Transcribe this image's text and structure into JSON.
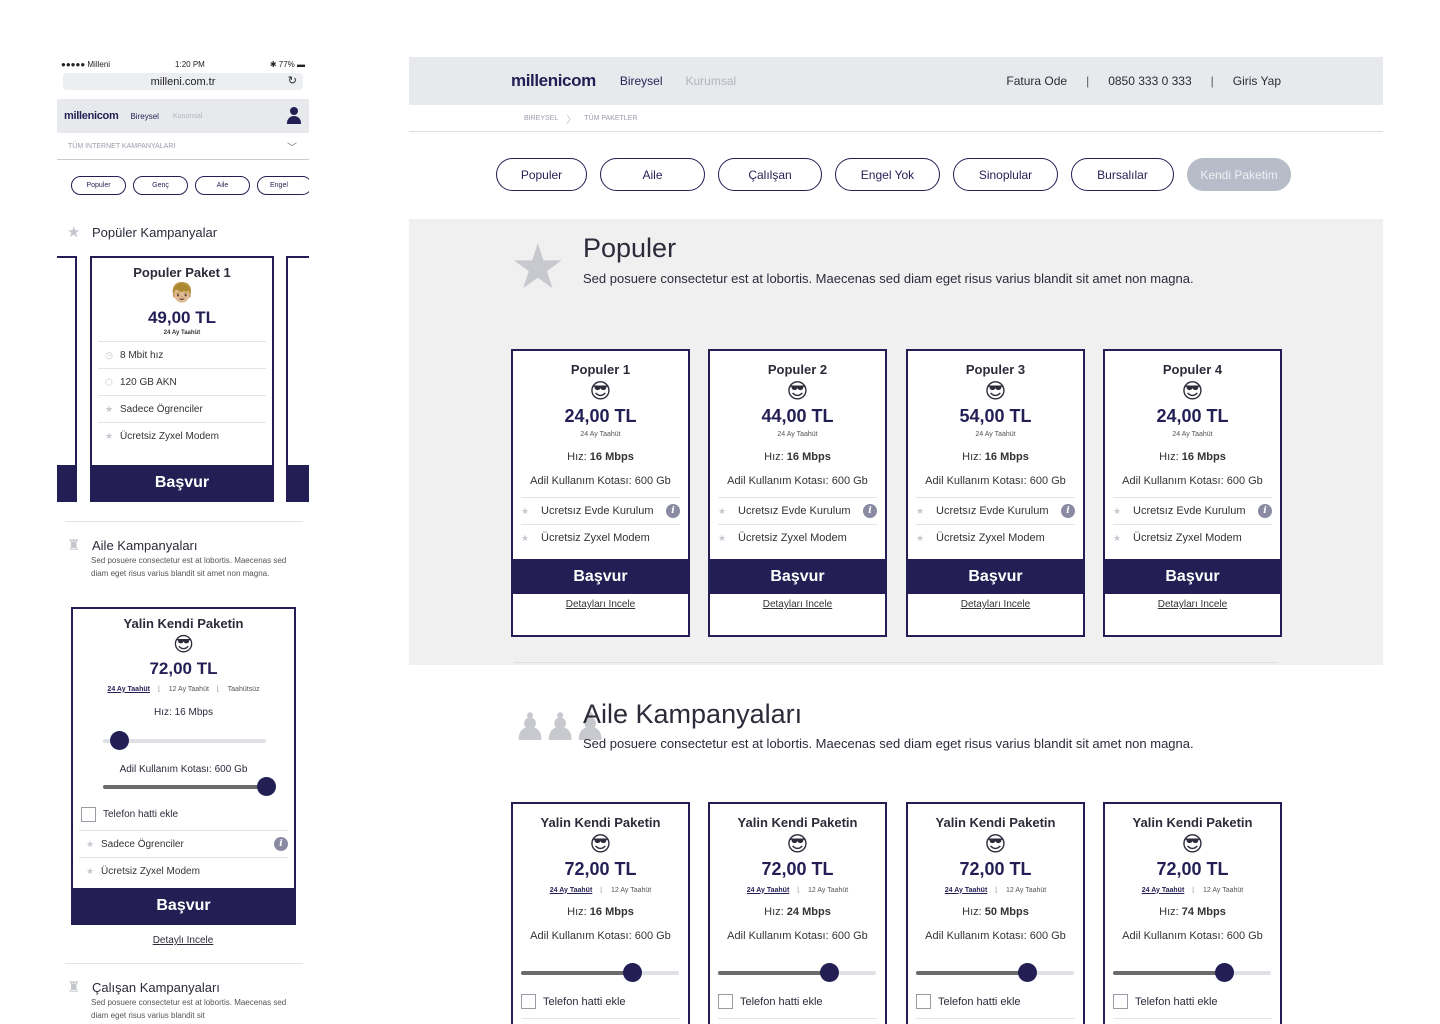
{
  "mobile": {
    "status": {
      "carrier": "●●●●● Milleni",
      "time": "1:20 PM",
      "battery": "77%"
    },
    "url": "milleni.com.tr",
    "nav": {
      "logo": "millenicom",
      "bireysel": "Bireysel",
      "kurumsal": "Kurumsal"
    },
    "select": "TÜM INTERNET KAMPANYALARI",
    "pills": [
      "Populer",
      "Genç",
      "Aile",
      "Engel"
    ],
    "popular_title": "Popüler Kampanyalar",
    "popular_card": {
      "title": "Populer Paket 1",
      "price": "49,00 TL",
      "commitment": "24 Ay Taahüt",
      "features": [
        "8 Mbit hız",
        "120 GB AKN",
        "Sadece Ögrenciler",
        "Ücretsiz Zyxel Modem"
      ],
      "cta": "Başvur"
    },
    "aile_title": "Aile Kampanyaları",
    "aile_desc": "Sed posuere consectetur est at lobortis. Maecenas sed diam eget risus varius blandit sit amet non magna.",
    "aile_card": {
      "title": "Yalin Kendi Paketin",
      "price": "72,00 TL",
      "terms": [
        "24 Ay Taahüt",
        "12 Ay Taahüt",
        "Taahütsüz"
      ],
      "speed": "Hız: 16 Mbps",
      "quota": "Adil Kullanım Kotası: 600 Gb",
      "phone": "Telefon hatti ekle",
      "features": [
        "Sadece Ögrenciler",
        "Ücretsiz Zyxel Modem"
      ],
      "cta": "Başvur",
      "detail": "Detaylı Incele",
      "speed_level": 0.1,
      "quota_level": 1.0
    },
    "calisan_title": "Çalışan Kampanyaları",
    "calisan_desc": "Sed posuere consectetur est at lobortis. Maecenas sed diam eget risus varius blandit sit"
  },
  "desktop": {
    "nav": {
      "logo": "millenicom",
      "bireysel": "Bireysel",
      "kurumsal": "Kurumsal",
      "fatura": "Fatura Ode",
      "phone": "0850 333 0 333",
      "login": "Giris Yap",
      "sep": "|"
    },
    "breadcrumb": [
      "BIREYSEL",
      "TÜM PAKETLER"
    ],
    "tabs": [
      "Populer",
      "Aile",
      "Çalılşan",
      "Engel Yok",
      "Sinoplular",
      "Bursalılar",
      "Kendi Paketim"
    ],
    "populer": {
      "title": "Populer",
      "desc": "Sed posuere consectetur est at lobortis. Maecenas sed diam eget risus varius blandit sit amet non magna.",
      "cards": [
        {
          "title": "Populer 1",
          "price": "24,00 TL"
        },
        {
          "title": "Populer 2",
          "price": "44,00 TL"
        },
        {
          "title": "Populer 3",
          "price": "54,00 TL"
        },
        {
          "title": "Populer 4",
          "price": "24,00 TL"
        }
      ],
      "commitment": "24 Ay Taahüt",
      "speed_label": "Hız:",
      "speed_value": "16 Mbps",
      "quota": "Adil Kullanım Kotası: 600 Gb",
      "features": [
        "Ucretsız Evde Kurulum",
        "Ücretsiz Zyxel Modem"
      ],
      "cta": "Başvur",
      "detail": "Detayları Incele"
    },
    "aile": {
      "title": "Aile Kampanyaları",
      "desc": "Sed posuere consectetur est at lobortis. Maecenas sed diam eget risus varius blandit sit amet non magna.",
      "cards": [
        {
          "title": "Yalin Kendi Paketin",
          "price": "72,00 TL",
          "speed_value": "16 Mbps"
        },
        {
          "title": "Yalin Kendi Paketin",
          "price": "72,00 TL",
          "speed_value": "24 Mbps"
        },
        {
          "title": "Yalin Kendi Paketin",
          "price": "72,00 TL",
          "speed_value": "50 Mbps"
        },
        {
          "title": "Yalin Kendi Paketin",
          "price": "72,00 TL",
          "speed_value": "74 Mbps"
        }
      ],
      "terms": [
        "24 Ay Taahüt",
        "12 Ay Taahüt"
      ],
      "speed_label": "Hız:",
      "quota": "Adil Kullanım Kotası: 600 Gb",
      "quota_level": 0.7,
      "phone": "Telefon hatti ekle"
    }
  }
}
